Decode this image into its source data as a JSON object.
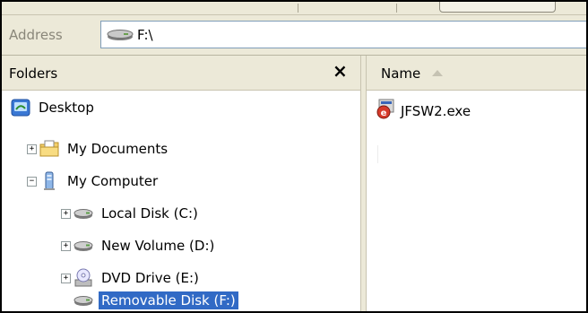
{
  "address": {
    "label": "Address",
    "value": "F:\\"
  },
  "folders": {
    "title": "Folders",
    "close_glyph": "×",
    "tree": [
      {
        "label": "Desktop",
        "icon": "desktop-icon",
        "expander": ""
      },
      {
        "label": "My Documents",
        "icon": "my-documents-folder-icon",
        "expander": "+"
      },
      {
        "label": "My Computer",
        "icon": "my-computer-icon",
        "expander": "−"
      },
      {
        "label": "Local Disk (C:)",
        "icon": "hard-disk-icon",
        "expander": "+"
      },
      {
        "label": "New Volume (D:)",
        "icon": "hard-disk-icon",
        "expander": "+"
      },
      {
        "label": "DVD Drive (E:)",
        "icon": "dvd-drive-icon",
        "expander": "+"
      },
      {
        "label": "Removable Disk (F:)",
        "icon": "removable-disk-icon",
        "expander": "",
        "selected": true
      }
    ]
  },
  "content": {
    "column_name": "Name",
    "sort": "ascending",
    "files": [
      {
        "name": "JFSW2.exe",
        "icon": "exe-file-icon"
      }
    ]
  },
  "colors": {
    "selection": "#316ac5",
    "chrome": "#ece9d8"
  }
}
